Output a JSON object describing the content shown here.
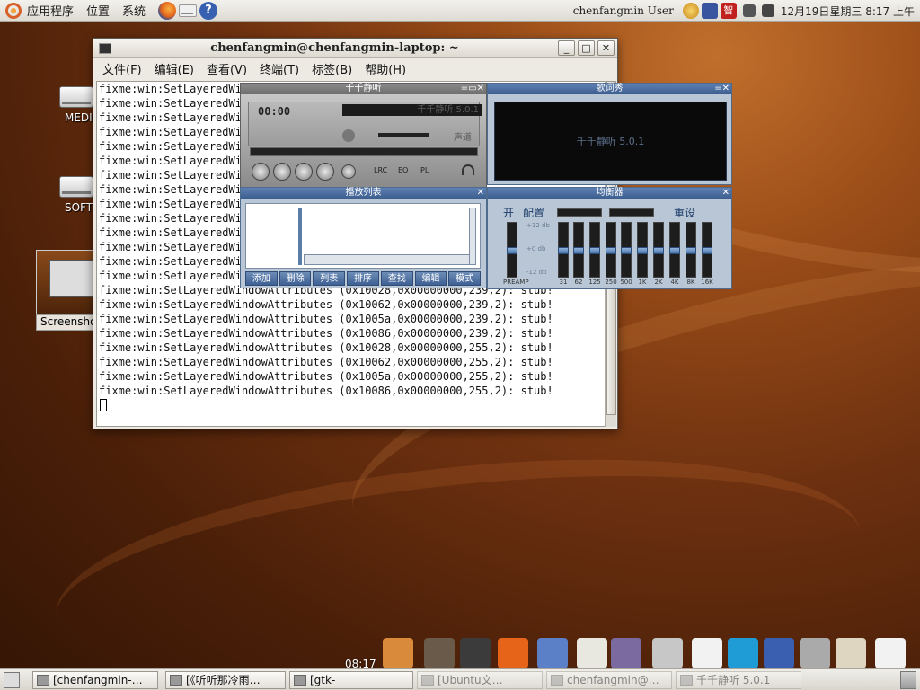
{
  "top_panel": {
    "menus": [
      "应用程序",
      "位置",
      "系统"
    ],
    "launchers": [
      "firefox-icon",
      "mail-icon",
      "help-icon"
    ],
    "user": "chenfangmin User",
    "tray": [
      "smiley-icon",
      "keyboard-icon",
      "ime-zhi-icon",
      "network-icon",
      "volume-icon"
    ],
    "clock": "12月19日星期三 8:17 上午"
  },
  "desktop_icons": [
    {
      "label": "MEDIA"
    },
    {
      "label": "SOFTWA"
    },
    {
      "label": "Screensho"
    }
  ],
  "terminal": {
    "title": "chenfangmin@chenfangmin-laptop: ~",
    "menus": [
      "文件(F)",
      "编辑(E)",
      "查看(V)",
      "终端(T)",
      "标签(B)",
      "帮助(H)"
    ],
    "lines": [
      "fixme:win:SetLayeredWin",
      "fixme:win:SetLayeredWin",
      "fixme:win:SetLayeredWin",
      "fixme:win:SetLayeredWin",
      "fixme:win:SetLayeredWin",
      "fixme:win:SetLayeredWin",
      "fixme:win:SetLayeredWin",
      "fixme:win:SetLayeredWin",
      "fixme:win:SetLayeredWin",
      "fixme:win:SetLayeredWin",
      "fixme:win:SetLayeredWin",
      "fixme:win:SetLayeredWin",
      "fixme:win:SetLayeredWin",
      "fixme:win:SetLayeredWin",
      "fixme:win:SetLayeredWindowAttributes (0x10028,0x00000000,239,2): stub!",
      "fixme:win:SetLayeredWindowAttributes (0x10062,0x00000000,239,2): stub!",
      "fixme:win:SetLayeredWindowAttributes (0x1005a,0x00000000,239,2): stub!",
      "fixme:win:SetLayeredWindowAttributes (0x10086,0x00000000,239,2): stub!",
      "fixme:win:SetLayeredWindowAttributes (0x10028,0x00000000,255,2): stub!",
      "fixme:win:SetLayeredWindowAttributes (0x10062,0x00000000,255,2): stub!",
      "fixme:win:SetLayeredWindowAttributes (0x1005a,0x00000000,255,2): stub!",
      "fixme:win:SetLayeredWindowAttributes (0x10086,0x00000000,255,2): stub!"
    ]
  },
  "ttplayer": {
    "main_title": "千千静听",
    "time": "00:00",
    "song_display": "千千静听 5.0.1",
    "channel_label": "声道",
    "tabs": [
      "LRC",
      "EQ",
      "PL"
    ],
    "lyric_title": "歌词秀",
    "lyric_text": "千千静听 5.0.1",
    "playlist_title": "播放列表",
    "playlist_buttons": [
      "添加",
      "删除",
      "列表",
      "排序",
      "查找",
      "编辑",
      "模式"
    ],
    "eq_title": "均衡器",
    "eq_on": "开",
    "eq_config": "配置",
    "eq_reset": "重设",
    "eq_db": [
      "+12 db",
      "+0 db",
      "-12 db"
    ],
    "eq_bands": [
      "PREAMP",
      "31",
      "62",
      "125",
      "250",
      "500",
      "1K",
      "2K",
      "4K",
      "8K",
      "16K"
    ]
  },
  "dock": {
    "time": "08:17",
    "icons": [
      "home-folder-icon",
      "system-tools-icon",
      "terminal-icon",
      "firefox-icon",
      "mplayer-icon",
      "document-icon",
      "pidgin-icon",
      "chat-icon",
      "window-icon",
      "skype-icon",
      "grid-icon",
      "pin-icon",
      "notes-icon",
      "window2-icon"
    ]
  },
  "taskbar": {
    "tasks": [
      {
        "label": "[chenfangmin-…",
        "dim": false
      },
      {
        "label": "[《听听那冷雨…",
        "dim": false
      },
      {
        "label": "[gtk-",
        "dim": false
      },
      {
        "label": "[Ubuntu文…",
        "dim": true
      },
      {
        "label": "chenfangmin@…",
        "dim": true
      },
      {
        "label": "千千静听 5.0.1",
        "dim": true
      }
    ]
  }
}
